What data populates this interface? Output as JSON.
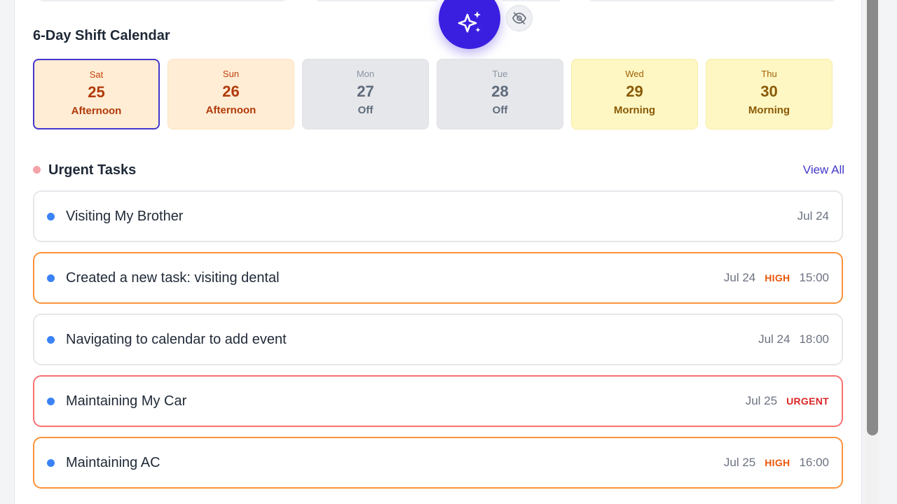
{
  "calendar": {
    "title": "6-Day Shift Calendar",
    "days": [
      {
        "day": "Sat",
        "date": "25",
        "shift": "Afternoon"
      },
      {
        "day": "Sun",
        "date": "26",
        "shift": "Afternoon"
      },
      {
        "day": "Mon",
        "date": "27",
        "shift": "Off"
      },
      {
        "day": "Tue",
        "date": "28",
        "shift": "Off"
      },
      {
        "day": "Wed",
        "date": "29",
        "shift": "Morning"
      },
      {
        "day": "Thu",
        "date": "30",
        "shift": "Morning"
      }
    ]
  },
  "urgent": {
    "title": "Urgent Tasks",
    "view_all": "View All",
    "tasks": [
      {
        "title": "Visiting My Brother",
        "date": "Jul 24",
        "priority": "",
        "time": ""
      },
      {
        "title": "Created a new task: visiting dental",
        "date": "Jul 24",
        "priority": "HIGH",
        "time": "15:00"
      },
      {
        "title": "Navigating to calendar to add event",
        "date": "Jul 24",
        "priority": "",
        "time": "18:00"
      },
      {
        "title": "Maintaining My Car",
        "date": "Jul 25",
        "priority": "URGENT",
        "time": ""
      },
      {
        "title": "Maintaining AC",
        "date": "Jul 25",
        "priority": "HIGH",
        "time": "16:00"
      }
    ]
  },
  "colors": {
    "accent": "#3b1fe0",
    "selected_border": "#4338ca",
    "task_bullet": "#3b82f6",
    "high": "#ea580c",
    "urgent": "#dc2626"
  },
  "icons": {
    "fab": "sparkles-icon",
    "hide": "eye-off-icon"
  }
}
